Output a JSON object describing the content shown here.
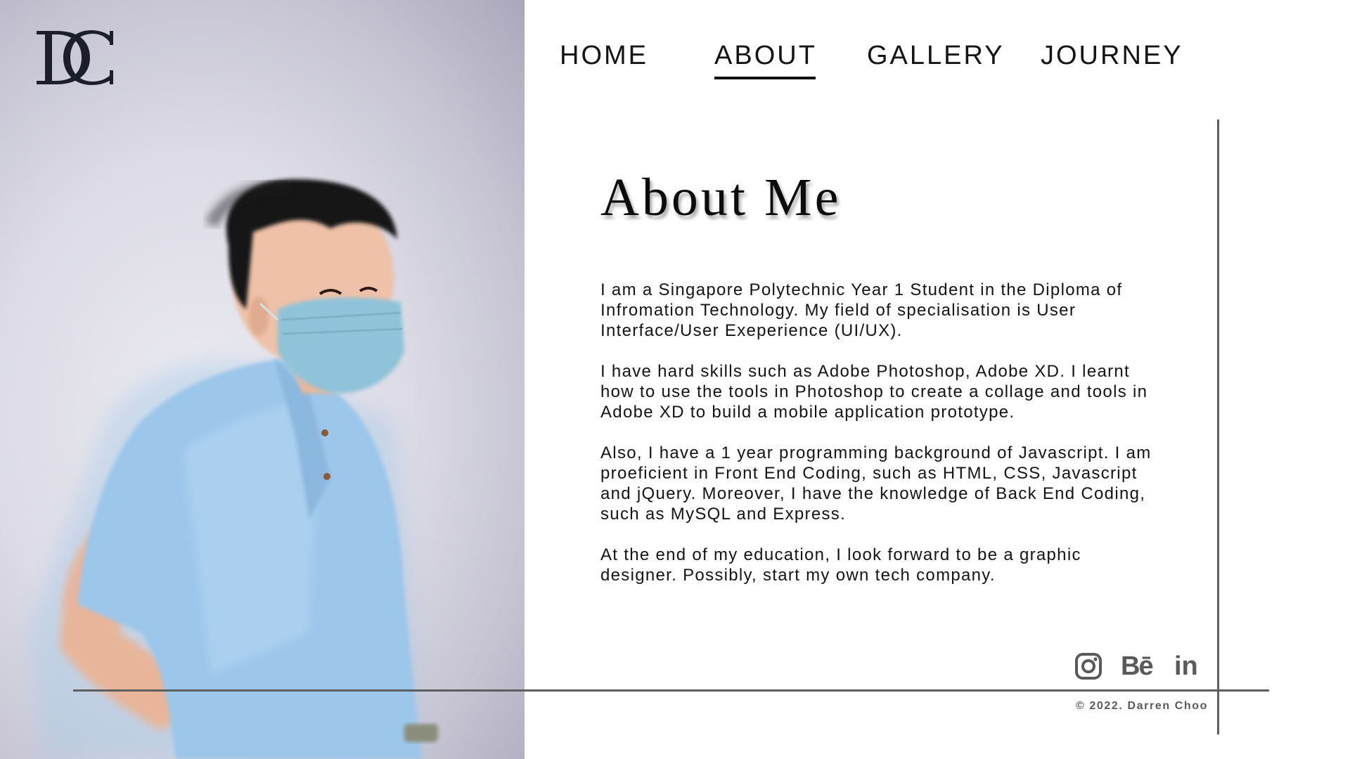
{
  "logo": {
    "icon": "dc-monogram-icon"
  },
  "nav": {
    "items": [
      {
        "label": "HOME",
        "active": false
      },
      {
        "label": "ABOUT",
        "active": true
      },
      {
        "label": "GALLERY",
        "active": false
      },
      {
        "label": "JOURNEY",
        "active": false
      }
    ]
  },
  "main": {
    "title": "About Me",
    "paragraphs": [
      "I am a Singapore Polytechnic Year 1 Student in the Diploma of Infromation Technology. My field of specialisation is User Interface/User Exeperience (UI/UX).",
      "I have hard skills such as Adobe Photoshop, Adobe XD. I learnt how to use the tools in Photoshop to create a collage and tools in Adobe XD to build a mobile application prototype.",
      "Also, I have a 1 year programming background of Javascript. I am proeficient in Front End Coding, such as HTML, CSS, Javascript and jQuery. Moreover, I have the knowledge of Back End Coding, such as MySQL and Express.",
      "At the end of my education, I look forward to be a graphic designer. Possibly, start my own tech company."
    ]
  },
  "social": {
    "icons": [
      "instagram-icon",
      "behance-icon",
      "linkedin-icon"
    ],
    "behance_text": "Bē",
    "linkedin_text": "in"
  },
  "footer": {
    "copyright": "© 2022. Darren Choo"
  },
  "colors": {
    "line": "#5e5e5e",
    "text": "#141414",
    "muted": "#5a5a5a"
  }
}
